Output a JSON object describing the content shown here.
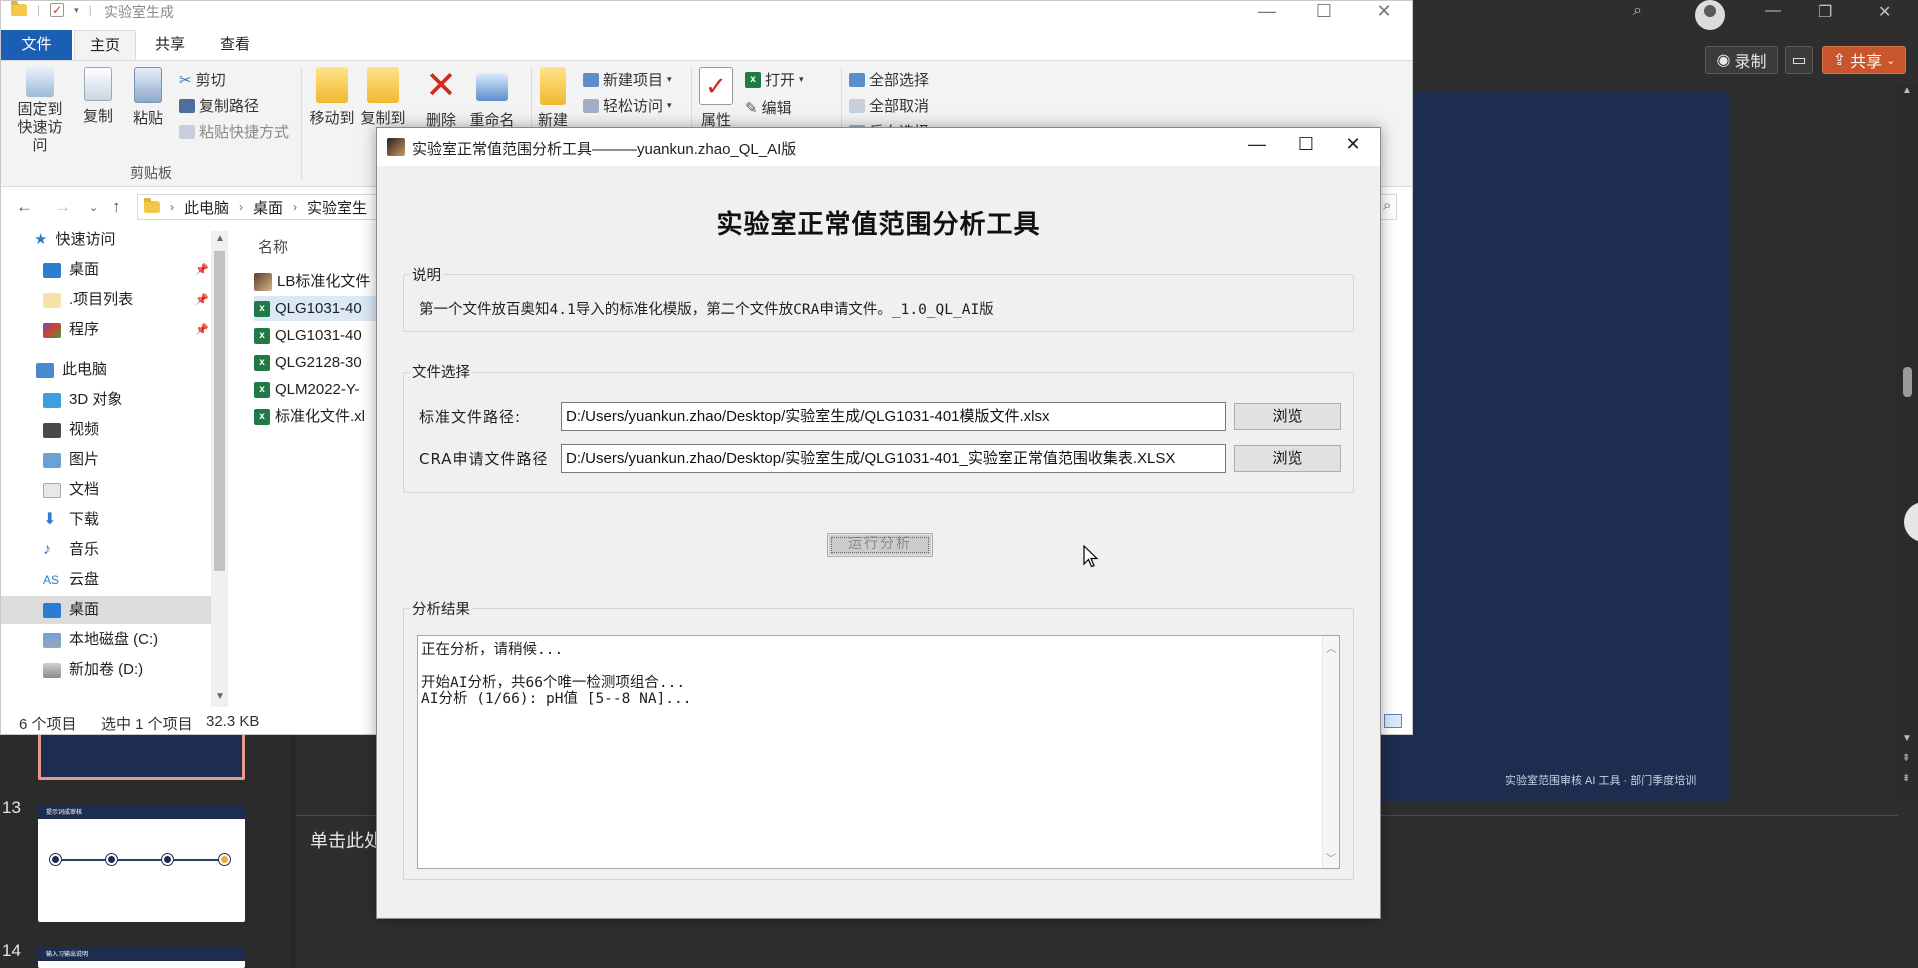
{
  "powerpoint": {
    "record_label": "录制",
    "share_label": "共享",
    "slide_footer": "实验室范围审核 AI 工具 · 部门季度培训",
    "notes_placeholder": "单击此处",
    "thumb_13_number": "13",
    "thumb_14_number": "14",
    "thumb_13_title": "提示词成审核",
    "thumb_14_title": "输入习输出说明"
  },
  "explorer": {
    "window_title": "实验室生成",
    "tabs": {
      "file": "文件",
      "home": "主页",
      "share": "共享",
      "view": "查看"
    },
    "ribbon": {
      "pin_label": "固定到\n快速访问",
      "copy_label": "复制",
      "paste_label": "粘贴",
      "cut_label": "剪切",
      "copy_path_label": "复制路径",
      "paste_shortcut_label": "粘贴快捷方式",
      "clipboard_group": "剪贴板",
      "move_to_label": "移动到",
      "copy_to_label": "复制到",
      "delete_label": "删除",
      "rename_label": "重命名",
      "new_folder_label": "新建",
      "new_item_label": "新建项目",
      "easy_access_label": "轻松访问",
      "properties_label": "属性",
      "open_label": "打开",
      "edit_label": "编辑",
      "select_all_label": "全部选择",
      "select_none_label": "全部取消",
      "invert_select_label": "反向选择"
    },
    "breadcrumb": [
      "此电脑",
      "桌面",
      "实验室生"
    ],
    "nav": {
      "quick_access": "快速访问",
      "desktop": "桌面",
      "project_list": ".项目列表",
      "programs": "程序",
      "this_pc": "此电脑",
      "objects_3d": "3D 对象",
      "videos": "视频",
      "pictures": "图片",
      "documents": "文档",
      "downloads": "下载",
      "music": "音乐",
      "cloud": "云盘",
      "desktop2": "桌面",
      "local_disk_c": "本地磁盘 (C:)",
      "new_volume_d": "新加卷 (D:)"
    },
    "column_name": "名称",
    "files": [
      {
        "name": "LB标准化文件",
        "type": "image"
      },
      {
        "name": "QLG1031-40",
        "type": "xlsx",
        "selected": true
      },
      {
        "name": "QLG1031-40",
        "type": "xlsx"
      },
      {
        "name": "QLG2128-30",
        "type": "xlsx"
      },
      {
        "name": "QLM2022-Y-",
        "type": "xlsx"
      },
      {
        "name": "标准化文件.xl",
        "type": "xlsx"
      }
    ],
    "status": {
      "count": "6 个项目",
      "selection": "选中 1 个项目",
      "size": "32.3 KB"
    }
  },
  "dialog": {
    "title": "实验室正常值范围分析工具———yuankun.zhao_QL_AI版",
    "heading": "实验室正常值范围分析工具",
    "description_group": "说明",
    "description_text": "第一个文件放百奥知4.1导入的标准化模版，第二个文件放CRA申请文件。_1.0_QL_AI版",
    "file_group": "文件选择",
    "standard_label": "标准文件路径:",
    "standard_path": "D:/Users/yuankun.zhao/Desktop/实验室生成/QLG1031-401模版文件.xlsx",
    "cra_label": "CRA申请文件路径",
    "cra_path": "D:/Users/yuankun.zhao/Desktop/实验室生成/QLG1031-401_实验室正常值范围收集表.XLSX",
    "browse_label": "浏览",
    "run_label": "运行分析",
    "result_group": "分析结果",
    "result_lines": [
      "正在分析，请稍候...",
      "",
      "开始AI分析，共66个唯一检测项组合...",
      "AI分析 (1/66): pH值 [5--8 NA]..."
    ]
  }
}
